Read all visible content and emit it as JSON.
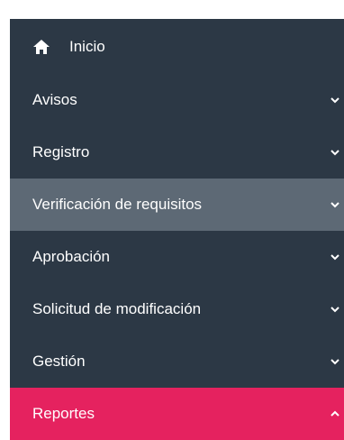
{
  "sidebar": {
    "colors": {
      "background": "#2c3845",
      "active_background": "#5d6975",
      "selected_background": "#e5225f",
      "text": "#ffffff"
    },
    "items": [
      {
        "label": "Inicio",
        "icon": "home-icon"
      },
      {
        "label": "Avisos",
        "icon": "chevron-down-icon"
      },
      {
        "label": "Registro",
        "icon": "chevron-down-icon"
      },
      {
        "label": "Verificación de requisitos",
        "icon": "chevron-down-icon",
        "state": "active"
      },
      {
        "label": "Aprobación",
        "icon": "chevron-down-icon"
      },
      {
        "label": "Solicitud de modificación",
        "icon": "chevron-down-icon"
      },
      {
        "label": "Gestión",
        "icon": "chevron-down-icon"
      },
      {
        "label": "Reportes",
        "icon": "chevron-up-icon",
        "state": "expanded"
      }
    ]
  }
}
